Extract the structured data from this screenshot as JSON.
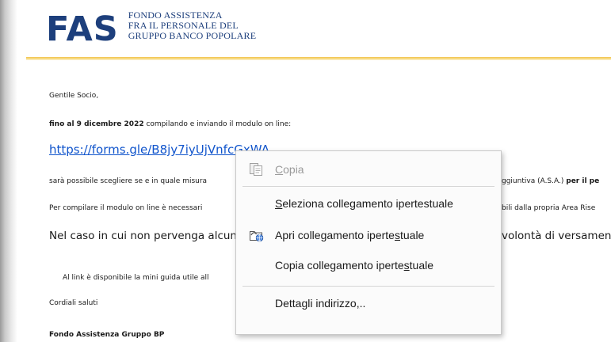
{
  "logo": {
    "mark": "FAS",
    "line1": "FONDO ASSISTENZA",
    "line2": "FRA IL PERSONALE DEL",
    "line3": "GRUPPO BANCO POPOLARE"
  },
  "email": {
    "greeting": "Gentile Socio,",
    "deadline_bold": "fino al 9 dicembre 2022",
    "deadline_rest": " compilando e inviando il modulo on line:",
    "link": "https://forms.gle/B8jy7iyUjVnfcGxWA",
    "para1_left": "sarà possibile scegliere se e in quale misura",
    "para1_right": "ggiuntiva (A.S.A.) ",
    "para1_right_bold": "per il pe",
    "para2_left": "Per compilare il modulo on line è necessari",
    "para2_right": "bili dalla propria Area Rise",
    "para3_left": "Nel caso in cui non pervenga alcun",
    "para3_right": "volontà di versament",
    "para4_left": "Al link è disponibile la mini guida utile all",
    "closing": "Cordiali saluti",
    "signature": "Fondo Assistenza Gruppo BP"
  },
  "context_menu": {
    "items": [
      {
        "pre": "",
        "key": "C",
        "post": "opia",
        "disabled": true,
        "icon": "copy-icon"
      },
      {
        "pre": "",
        "key": "S",
        "post": "eleziona collegamento ipertestuale",
        "disabled": false,
        "icon": ""
      },
      {
        "pre": "Apri collegamento iperte",
        "key": "s",
        "post": "tuale",
        "disabled": false,
        "icon": "open-link-icon"
      },
      {
        "pre": "Copia collegamento iperte",
        "key": "s",
        "post": "tuale",
        "disabled": false,
        "icon": ""
      },
      {
        "pre": "Dettagli indirizzo",
        "key": ",",
        "post": "..",
        "disabled": false,
        "icon": ""
      }
    ]
  },
  "colors": {
    "link": "#1155cc",
    "brand": "#1d3f7c",
    "header_line": "#f2c44f",
    "menu_bg": "#fbfbfb",
    "disabled_text": "#9b9b9b"
  }
}
